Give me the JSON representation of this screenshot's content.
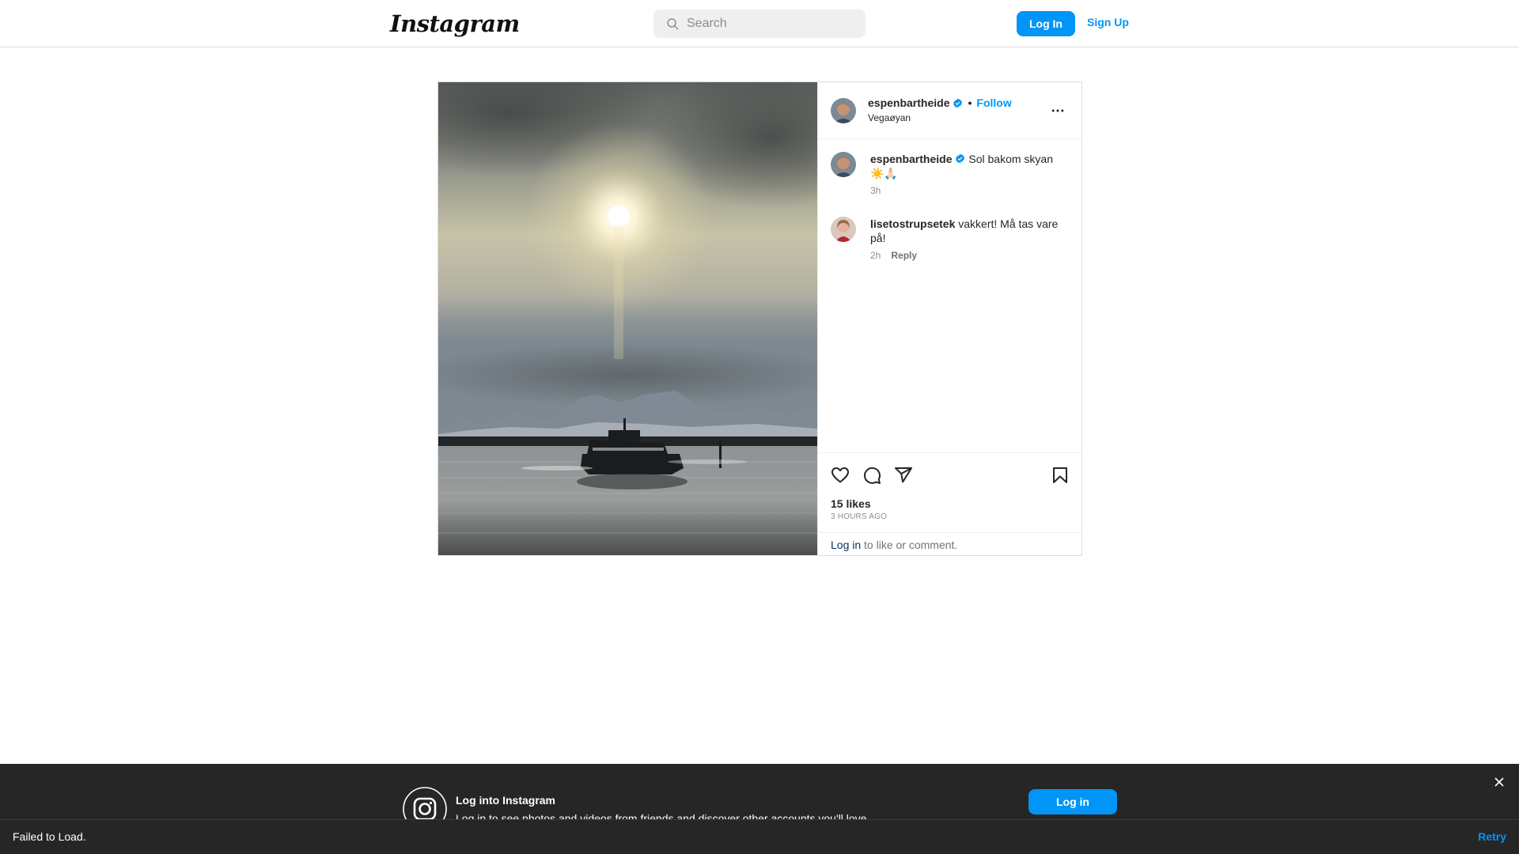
{
  "header": {
    "logo": "Instagram",
    "search_placeholder": "Search",
    "login_label": "Log In",
    "signup_label": "Sign Up"
  },
  "post": {
    "author": "espenbartheide",
    "location": "Vegaøyan",
    "follow_label": "Follow",
    "separator": "•",
    "caption": {
      "user": "espenbartheide",
      "text": "Sol bakom skyan ☀️🙏🏻",
      "time": "3h"
    },
    "comments": [
      {
        "user": "lisetostrupsetek",
        "text": "vakkert! Må tas vare på!",
        "time": "2h",
        "reply_label": "Reply"
      }
    ],
    "likes": "15 likes",
    "posted": "3 HOURS AGO",
    "login_link": "Log in",
    "login_prompt": " to like or comment."
  },
  "banner": {
    "title": "Log into Instagram",
    "subtitle": "Log in to see photos and videos from friends and discover other accounts you'll love.",
    "login_label": "Log in",
    "status_text": "Failed to Load.",
    "retry_label": "Retry"
  },
  "colors": {
    "accent": "#0095f6",
    "link_dark": "#00376b",
    "banner_bg": "#262626"
  },
  "icons": [
    "search-icon",
    "verified-icon",
    "more-options-icon",
    "heart-icon",
    "comment-icon",
    "share-icon",
    "bookmark-icon",
    "instagram-icon",
    "close-icon"
  ]
}
